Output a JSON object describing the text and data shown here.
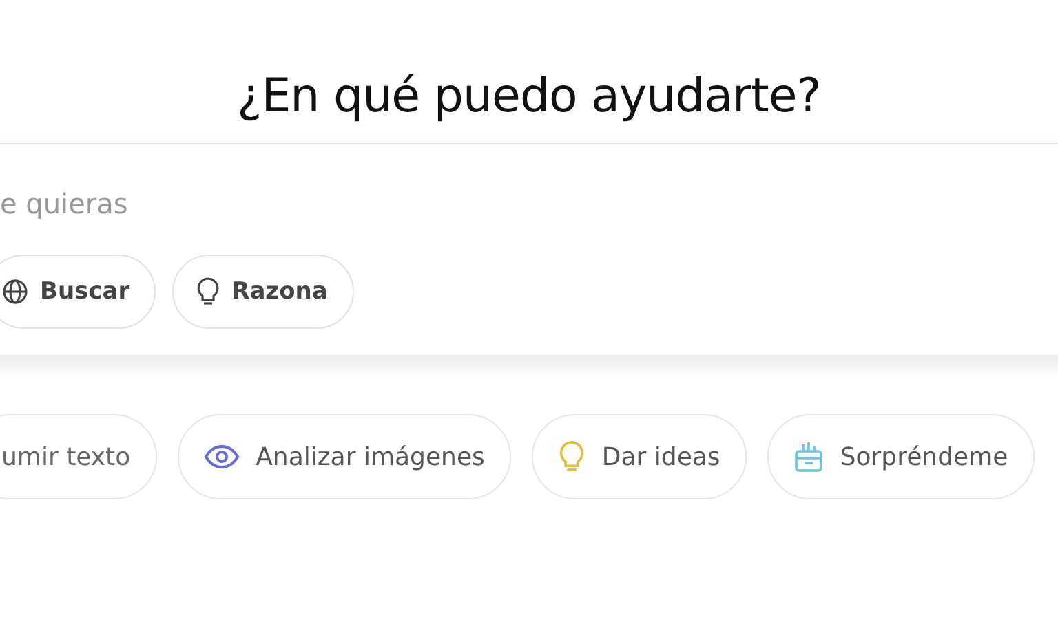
{
  "heading": "¿En qué puedo ayudarte?",
  "prompt": {
    "placeholder": "e quieras"
  },
  "tools": [
    {
      "label": "Buscar",
      "kind": "globe"
    },
    {
      "label": "Razona",
      "kind": "bulb"
    }
  ],
  "suggestions": [
    {
      "label": "umir texto",
      "kind": "none",
      "color": "#666666"
    },
    {
      "label": "Analizar imágenes",
      "kind": "eye",
      "color": "#6b6bd6"
    },
    {
      "label": "Dar ideas",
      "kind": "bulb",
      "color": "#e0bd3a"
    },
    {
      "label": "Sorpréndeme",
      "kind": "gift",
      "color": "#6fc3db"
    }
  ]
}
